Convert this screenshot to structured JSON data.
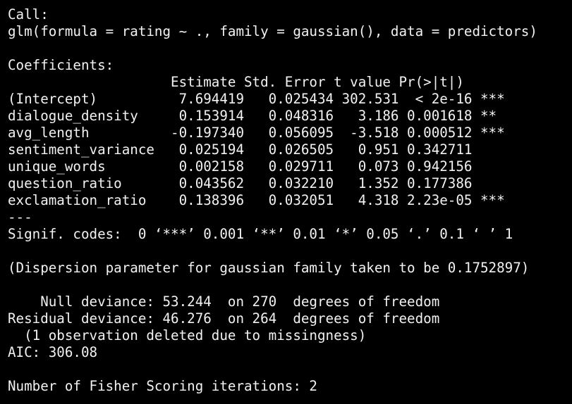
{
  "colors": {
    "background": "#000000",
    "text": "#f2f2f2"
  },
  "call_header": "Call:",
  "call": "glm(formula = rating ~ ., family = gaussian(), data = predictors)",
  "coef_header": "Coefficients:",
  "coef_table_header": "                    Estimate Std. Error t value Pr(>|t|)",
  "coef_rows": [
    "(Intercept)          7.694419   0.025434 302.531  < 2e-16 ***",
    "dialogue_density     0.153914   0.048316   3.186 0.001618 ** ",
    "avg_length          -0.197340   0.056095  -3.518 0.000512 ***",
    "sentiment_variance   0.025194   0.026505   0.951 0.342711    ",
    "unique_words         0.002158   0.029711   0.073 0.942156    ",
    "question_ratio       0.043562   0.032210   1.352 0.177386    ",
    "exclamation_ratio    0.138396   0.032051   4.318 2.23e-05 ***"
  ],
  "signif_separator": "---",
  "signif_codes": "Signif. codes:  0 ‘***’ 0.001 ‘**’ 0.01 ‘*’ 0.05 ‘.’ 0.1 ‘ ’ 1",
  "dispersion": "(Dispersion parameter for gaussian family taken to be 0.1752897)",
  "null_deviance": "    Null deviance: 53.244  on 270  degrees of freedom",
  "residual_deviance": "Residual deviance: 46.276  on 264  degrees of freedom",
  "missing_note": "  (1 observation deleted due to missingness)",
  "aic": "AIC: 306.08",
  "fisher": "Number of Fisher Scoring iterations: 2"
}
